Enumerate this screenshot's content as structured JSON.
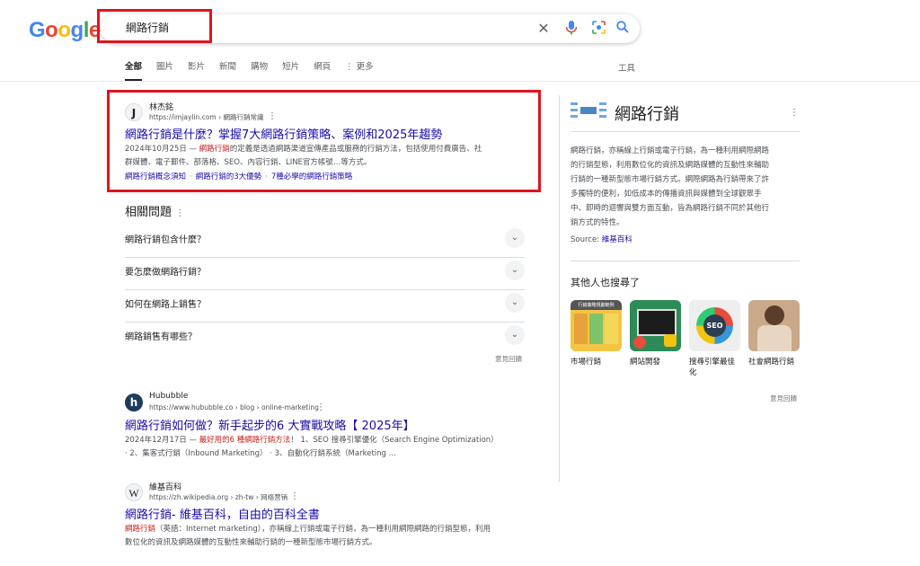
{
  "logo": {
    "l1": "G",
    "l2": "o",
    "l3": "o",
    "l4": "g",
    "l5": "l",
    "l6": "e"
  },
  "search": {
    "query": "網路行銷"
  },
  "icons": {
    "clear": "close-icon",
    "mic": "mic-icon",
    "lens": "camera-lens-icon",
    "search": "search-icon",
    "chevron": "chevron-down-icon",
    "more": "more-vert-icon"
  },
  "tabs": [
    "全部",
    "圖片",
    "影片",
    "新聞",
    "購物",
    "短片",
    "網頁",
    "⋮ 更多"
  ],
  "tools_label": "工具",
  "results": [
    {
      "site": "林杰銘",
      "url": "https://imjaylin.com › 網路行銷常識",
      "favicon": "J",
      "title": "網路行銷是什麼？掌握7大網路行銷策略、案例和2025年趨勢",
      "date": "2024年10月25日 — ",
      "snippet_hl": "網路行銷",
      "snippet_line1": "的定義是透過網路渠道宣傳產品或服務的行銷方法，包括使用付費廣告、社",
      "snippet_line2": "群媒體、電子郵件、部落格、SEO、內容行銷、LINE官方帳號…等方式。",
      "sublinks": [
        "網路行銷概念須知",
        "網路行銷的3大優勢",
        "7種必學的網路行銷策略"
      ]
    },
    {
      "site": "Hububble",
      "url": "https://www.hububble.co › blog › online-marketing",
      "favicon": "h",
      "title": "網路行銷如何做？新手起步的6 大實戰攻略【 2025年】",
      "date": "2024年12月17日 — ",
      "snippet_hl": "最好用的6 種網路行銷方法",
      "snippet_line1": "！ 1、SEO 搜尋引擎優化（Search Engine Optimization）",
      "snippet_line2": "· 2、集客式行銷（Inbound Marketing） · 3、自動化行銷系統（Marketing ..."
    },
    {
      "site": "維基百科",
      "url": "https://zh.wikipedia.org › zh-tw › 网络营销",
      "favicon": "W",
      "title": "網路行銷- 維基百科，自由的百科全書",
      "snippet_hl": "網路行銷",
      "snippet_line1": "（英語：Internet marketing），亦稱線上行銷或電子行銷，為一種利用網際網路的行銷型態，利用",
      "snippet_line2": "數位化的資訊及網路媒體的互動性來輔助行銷的一種新型態市場行銷方式。"
    }
  ],
  "paa": {
    "title": "相關問題",
    "questions": [
      "網路行銷包含什麼？",
      "要怎麼做網路行銷？",
      "如何在網路上銷售？",
      "網路銷售有哪些？"
    ],
    "feedback": "意見回饋"
  },
  "knowledge_panel": {
    "title": "網路行銷",
    "desc_lines": [
      "網路行銷，亦稱線上行銷或電子行銷，為一種利用網際網路",
      "的行銷型態，利用數位化的資訊及網路媒體的互動性來輔助",
      "行銷的一種新型態市場行銷方式。網際網路為行銷帶來了許",
      "多獨特的便利，如低成本的傳播資訊與媒體到全球觀眾手",
      "中、即時的迴響與雙方面互動，皆為網路行銷不同於其他行",
      "銷方式的特性。"
    ],
    "source_label": "Source: ",
    "source_link": "維基百科",
    "also_title": "其他人也搜尋了",
    "also": [
      {
        "label": "市場行銷",
        "thumb_text": "行銷策略規劃範例",
        "color": "#f4c542"
      },
      {
        "label": "網站開發",
        "thumb_text": "",
        "color": "#2e8b57"
      },
      {
        "label": "搜尋引擎最佳化",
        "thumb_text": "SEO",
        "color": "#ffffff"
      },
      {
        "label": "社會網路行銷",
        "thumb_text": "",
        "color": "#c9a98a"
      }
    ],
    "feedback": "意見回饋"
  }
}
